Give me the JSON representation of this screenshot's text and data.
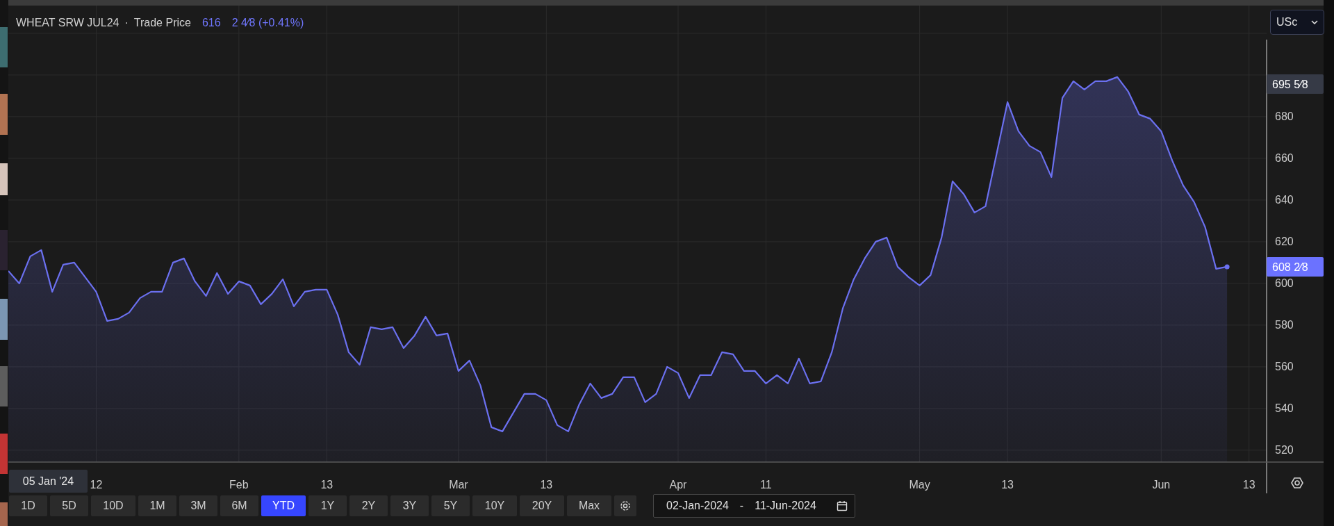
{
  "instrument": {
    "symbol": "WHEAT SRW JUL24",
    "separator": "·",
    "last": "616",
    "change": "2 4⁄8 (+0.41%)"
  },
  "currency_select": {
    "value": "USc"
  },
  "chart": {
    "crosshair_date": "05 Jan '24",
    "price_labels": [
      {
        "text": "695 5⁄8",
        "kind": "high"
      },
      {
        "text": "608 2⁄8",
        "kind": "last"
      }
    ],
    "chart_data": {
      "type": "area",
      "grid": true,
      "ylim": [
        514.3,
        733.3
      ],
      "categories": [
        null,
        null,
        null,
        null,
        null,
        null,
        null,
        null,
        "12",
        null,
        null,
        null,
        null,
        null,
        null,
        null,
        null,
        null,
        null,
        null,
        null,
        "Feb",
        null,
        null,
        null,
        null,
        null,
        null,
        null,
        "13",
        null,
        null,
        null,
        null,
        null,
        null,
        null,
        null,
        null,
        null,
        null,
        "Mar",
        null,
        null,
        null,
        null,
        null,
        null,
        null,
        "13",
        null,
        null,
        null,
        null,
        null,
        null,
        null,
        null,
        null,
        null,
        null,
        "Apr",
        null,
        null,
        null,
        null,
        null,
        null,
        null,
        "11",
        null,
        null,
        null,
        null,
        null,
        null,
        null,
        null,
        null,
        null,
        null,
        null,
        null,
        "May",
        null,
        null,
        null,
        null,
        null,
        null,
        null,
        "13",
        null,
        null,
        null,
        null,
        null,
        null,
        null,
        null,
        null,
        null,
        null,
        null,
        null,
        "Jun",
        null,
        null,
        null,
        null,
        null,
        null,
        null,
        "13",
        null
      ],
      "yticks": [
        520,
        540,
        560,
        580,
        600,
        620,
        640,
        660,
        680
      ],
      "series": [
        {
          "name": "Trade Price",
          "color": "#6b70f0",
          "values": [
            606,
            600,
            613,
            616,
            596,
            609,
            610,
            603,
            596,
            582,
            583,
            586,
            593,
            596,
            596,
            610,
            612,
            601,
            594,
            605,
            595,
            601,
            599,
            590,
            595,
            602,
            589,
            596,
            597,
            597,
            585,
            567,
            561,
            579,
            578,
            579,
            569,
            575,
            584,
            575,
            576,
            558,
            563,
            551,
            531,
            529,
            538,
            547,
            547,
            544,
            532,
            529,
            542,
            552,
            545,
            547,
            555,
            555,
            543,
            547,
            560,
            557,
            545,
            556,
            556,
            567,
            566,
            558,
            558,
            552,
            556,
            552,
            564,
            552,
            553,
            567,
            588,
            602,
            612,
            620,
            622,
            608,
            603,
            599,
            604,
            622,
            649,
            643,
            634,
            637,
            662,
            687,
            673,
            666,
            663,
            651,
            689,
            697,
            693,
            697,
            697,
            699,
            692,
            681,
            679,
            673,
            659,
            647,
            639,
            627,
            607,
            608,
            null,
            null,
            null
          ]
        }
      ]
    }
  },
  "ranges": [
    {
      "label": "1D",
      "selected": false
    },
    {
      "label": "5D",
      "selected": false
    },
    {
      "label": "10D",
      "selected": false
    },
    {
      "label": "1M",
      "selected": false
    },
    {
      "label": "3M",
      "selected": false
    },
    {
      "label": "6M",
      "selected": false
    },
    {
      "label": "YTD",
      "selected": true
    },
    {
      "label": "1Y",
      "selected": false
    },
    {
      "label": "2Y",
      "selected": false
    },
    {
      "label": "3Y",
      "selected": false
    },
    {
      "label": "5Y",
      "selected": false
    },
    {
      "label": "10Y",
      "selected": false
    },
    {
      "label": "20Y",
      "selected": false
    },
    {
      "label": "Max",
      "selected": false
    }
  ],
  "date_range": {
    "from": "02-Jan-2024",
    "separator": "-",
    "to": "11-Jun-2024"
  }
}
